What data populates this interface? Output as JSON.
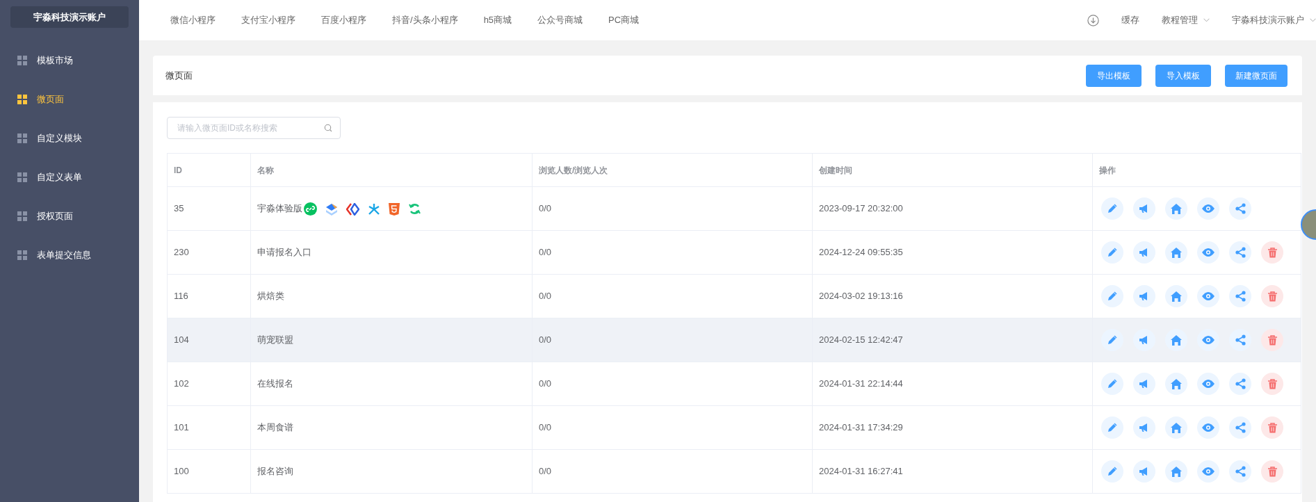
{
  "sidebar": {
    "account": "宇淼科技演示账户",
    "items": [
      {
        "label": "模板市场",
        "selected": false
      },
      {
        "label": "微页面",
        "selected": true
      },
      {
        "label": "自定义模块",
        "selected": false
      },
      {
        "label": "自定义表单",
        "selected": false
      },
      {
        "label": "授权页面",
        "selected": false
      },
      {
        "label": "表单提交信息",
        "selected": false
      }
    ]
  },
  "top_nav": {
    "tabs": [
      "微信小程序",
      "支付宝小程序",
      "百度小程序",
      "抖音/头条小程序",
      "h5商城",
      "公众号商城",
      "PC商城"
    ],
    "right": [
      {
        "kind": "icon"
      },
      {
        "kind": "link",
        "label": "缓存"
      },
      {
        "kind": "dropdown",
        "label": "教程管理"
      },
      {
        "kind": "dropdown",
        "label": "宇淼科技演示账户"
      }
    ]
  },
  "page_header": {
    "title": "微页面",
    "buttons": [
      "导出模板",
      "导入模板",
      "新建微页面"
    ]
  },
  "search": {
    "placeholder": "请输入微页面ID或名称搜索"
  },
  "table": {
    "columns": [
      "ID",
      "名称",
      "浏览人数/浏览人次",
      "创建时间",
      "操作"
    ],
    "rows": [
      {
        "id": "35",
        "name": "宇淼体验版",
        "views": "0/0",
        "created": "2023-09-17 20:32:00",
        "platform_icons": true,
        "deletable": false,
        "highlighted": false
      },
      {
        "id": "230",
        "name": "申请报名入口",
        "views": "0/0",
        "created": "2024-12-24 09:55:35",
        "platform_icons": false,
        "deletable": true,
        "highlighted": false
      },
      {
        "id": "116",
        "name": "烘焙类",
        "views": "0/0",
        "created": "2024-03-02 19:13:16",
        "platform_icons": false,
        "deletable": true,
        "highlighted": false
      },
      {
        "id": "104",
        "name": "萌宠联盟",
        "views": "0/0",
        "created": "2024-02-15 12:42:47",
        "platform_icons": false,
        "deletable": true,
        "highlighted": true
      },
      {
        "id": "102",
        "name": "在线报名",
        "views": "0/0",
        "created": "2024-01-31 22:14:44",
        "platform_icons": false,
        "deletable": true,
        "highlighted": false
      },
      {
        "id": "101",
        "name": "本周食谱",
        "views": "0/0",
        "created": "2024-01-31 17:34:29",
        "platform_icons": false,
        "deletable": true,
        "highlighted": false
      },
      {
        "id": "100",
        "name": "报名咨询",
        "views": "0/0",
        "created": "2024-01-31 16:27:41",
        "platform_icons": false,
        "deletable": true,
        "highlighted": false
      }
    ]
  }
}
